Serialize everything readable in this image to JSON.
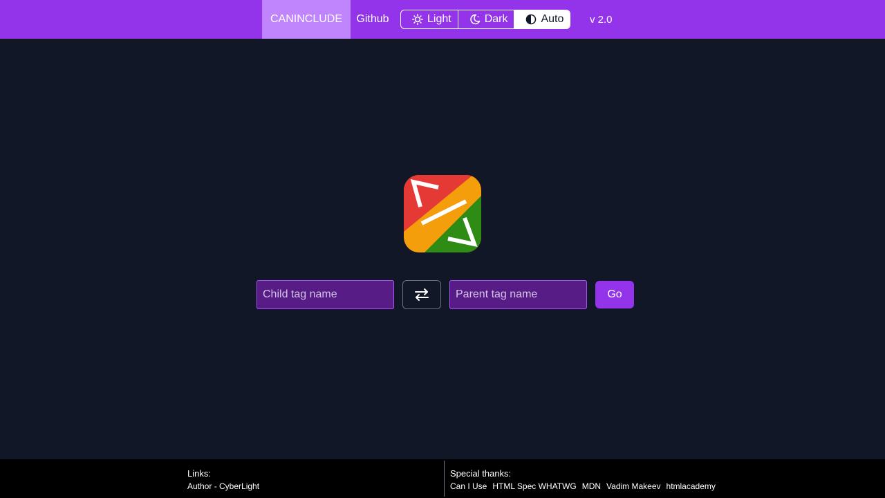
{
  "header": {
    "brand": "CANINCLUDE",
    "github": "Github",
    "themes": [
      {
        "label": "Light",
        "icon": "sun-icon",
        "active": false
      },
      {
        "label": "Dark",
        "icon": "moon-icon",
        "active": false
      },
      {
        "label": "Auto",
        "icon": "contrast-icon",
        "active": true
      }
    ],
    "version": "v 2.0"
  },
  "search": {
    "child_placeholder": "Child tag name",
    "parent_placeholder": "Parent tag name",
    "swap_icon": "swap-arrows-icon",
    "go_label": "Go"
  },
  "footer": {
    "links_heading": "Links:",
    "links": [
      "Author - CyberLight"
    ],
    "thanks_heading": "Special thanks:",
    "thanks": [
      "Can I Use",
      "HTML Spec WHATWG",
      "MDN",
      "Vadim Makeev",
      "htmlacademy"
    ]
  },
  "colors": {
    "header_bg": "#9333ea",
    "brand_bg": "#c084fc",
    "page_bg": "#111727",
    "input_bg": "#581c87",
    "footer_bg": "#000000"
  }
}
